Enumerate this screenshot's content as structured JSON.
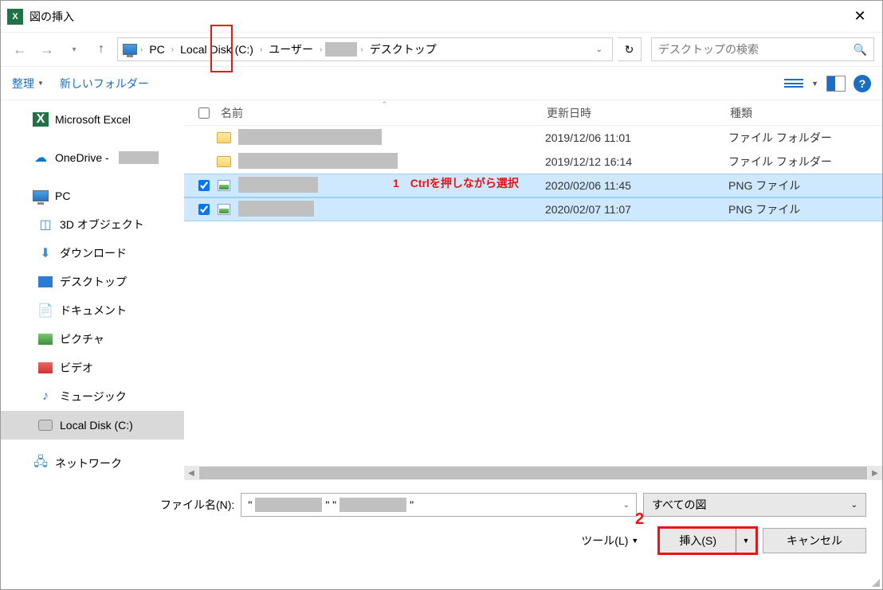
{
  "title": "図の挿入",
  "breadcrumb": {
    "pc": "PC",
    "disk": "Local Disk (C:)",
    "users": "ユーザー",
    "desktop": "デスクトップ"
  },
  "search_placeholder": "デスクトップの検索",
  "toolbar": {
    "organize": "整理",
    "newfolder": "新しいフォルダー"
  },
  "tree": {
    "excel": "Microsoft Excel",
    "onedrive": "OneDrive -",
    "pc": "PC",
    "obj3d": "3D オブジェクト",
    "downloads": "ダウンロード",
    "desktop": "デスクトップ",
    "documents": "ドキュメント",
    "pictures": "ピクチャ",
    "videos": "ビデオ",
    "music": "ミュージック",
    "localdisk": "Local Disk (C:)",
    "network": "ネットワーク"
  },
  "cols": {
    "name": "名前",
    "date": "更新日時",
    "type": "種類"
  },
  "rows": [
    {
      "date": "2019/12/06 11:01",
      "type": "ファイル フォルダー"
    },
    {
      "date": "2019/12/12 16:14",
      "type": "ファイル フォルダー"
    },
    {
      "date": "2020/02/06 11:45",
      "type": "PNG ファイル"
    },
    {
      "date": "2020/02/07 11:07",
      "type": "PNG ファイル"
    }
  ],
  "annot1_num": "1",
  "annot1_text": "Ctrlを押しながら選択",
  "annot2_num": "2",
  "filename_label": "ファイル名(N):",
  "filename_value": {
    "q1": "\"",
    "q2": "\" \"",
    "q3": "\""
  },
  "filter_label": "すべての図",
  "tools_label": "ツール(L)",
  "insert_label": "挿入(S)",
  "cancel_label": "キャンセル"
}
